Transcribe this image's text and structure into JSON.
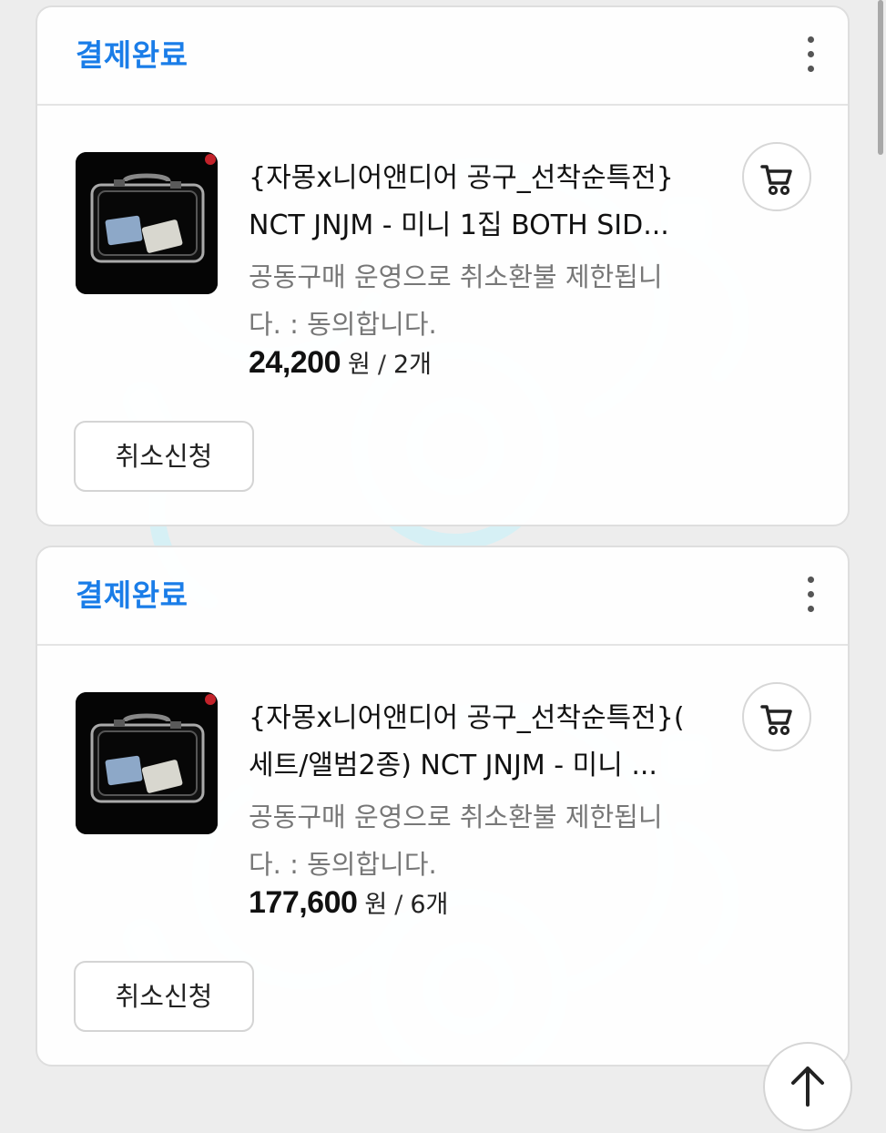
{
  "theme": {
    "accent": "#1a7de8",
    "page_bg": "#ededed",
    "card_bg": "#ffffff",
    "watermark": "#d8f2f7"
  },
  "orders": [
    {
      "status": "결제완료",
      "title_line1": "{자몽x니어앤디어 공구_선착순특전}",
      "title_line2": "NCT JNJM - 미니 1집 BOTH SID...",
      "notice_line1": "공동구매 운영으로 취소환불 제한됩니",
      "notice_line2": "다. : 동의합니다.",
      "price": "24,200",
      "currency": "원",
      "separator": "/",
      "quantity": "2개",
      "cancel_label": "취소신청",
      "icons": {
        "menu": "more-vertical-icon",
        "cart": "cart-icon"
      }
    },
    {
      "status": "결제완료",
      "title_line1": "{자몽x니어앤디어 공구_선착순특전}(",
      "title_line2": "세트/앨범2종) NCT JNJM - 미니 ...",
      "notice_line1": "공동구매 운영으로 취소환불 제한됩니",
      "notice_line2": "다. : 동의합니다.",
      "price": "177,600",
      "currency": "원",
      "separator": "/",
      "quantity": "6개",
      "cancel_label": "취소신청",
      "icons": {
        "menu": "more-vertical-icon",
        "cart": "cart-icon"
      }
    }
  ],
  "floating": {
    "scroll_top_icon": "arrow-up-icon"
  }
}
